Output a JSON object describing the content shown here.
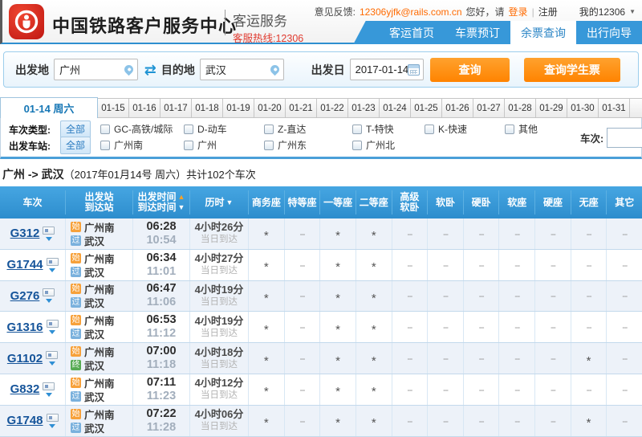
{
  "colors": {
    "nav_blue": "#3798d9",
    "table_header_blue": "#2d8dcd",
    "accent_orange": "#ff8300",
    "link_orange": "#ff6a00",
    "hotline_red": "#e03a2f",
    "active_tab_blue": "#1576b5",
    "badge_start": "#f7a13a",
    "badge_pass": "#7ab1dd",
    "badge_end": "#56ab53"
  },
  "header": {
    "title": "中国铁路客户服务中心",
    "subtitle": "客运服务",
    "hotline": "客服热线:12306",
    "feedback_label": "意见反馈:",
    "feedback_email": "12306yjfk@rails.com.cn",
    "greeting": "您好，请",
    "login": "登录",
    "divider": "|",
    "register": "注册",
    "my_account": "我的12306"
  },
  "nav": {
    "items": [
      {
        "label": "客运首页",
        "active": false
      },
      {
        "label": "车票预订",
        "active": false
      },
      {
        "label": "余票查询",
        "active": true
      },
      {
        "label": "出行向导",
        "active": false
      }
    ]
  },
  "search": {
    "from_label": "出发地",
    "from_value": "广州",
    "to_label": "目的地",
    "to_value": "武汉",
    "date_label": "出发日",
    "date_value": "2017-01-14",
    "query_button": "查询",
    "student_button": "查询学生票"
  },
  "date_tabs": {
    "active": "01-14 周六",
    "others": [
      "01-15",
      "01-16",
      "01-17",
      "01-18",
      "01-19",
      "01-20",
      "01-21",
      "01-22",
      "01-23",
      "01-24",
      "01-25",
      "01-26",
      "01-27",
      "01-28",
      "01-29",
      "01-30",
      "01-31"
    ]
  },
  "filters": {
    "type_label": "车次类型:",
    "all_label": "全部",
    "type_options": [
      "GC-高铁/城际",
      "D-动车",
      "Z-直达",
      "T-特快",
      "K-快速",
      "其他"
    ],
    "station_label": "出发车站:",
    "station_options": [
      "广州南",
      "广州",
      "广州东",
      "广州北"
    ],
    "train_no_label": "车次:"
  },
  "summary": {
    "route": "广州 -> 武汉",
    "rest": "（2017年01月14号  周六）共计102个车次"
  },
  "table": {
    "columns": [
      {
        "lines": [
          {
            "t": "车次"
          }
        ]
      },
      {
        "lines": [
          {
            "t": "出发站"
          },
          {
            "t": "到达站"
          }
        ]
      },
      {
        "lines": [
          {
            "t": "出发时间",
            "arrow": "up"
          },
          {
            "t": "到达时间",
            "arrow": "down"
          }
        ]
      },
      {
        "lines": [
          {
            "t": "历时",
            "arrow": "down"
          }
        ]
      },
      {
        "lines": [
          {
            "t": "商务座"
          }
        ]
      },
      {
        "lines": [
          {
            "t": "特等座"
          }
        ]
      },
      {
        "lines": [
          {
            "t": "一等座"
          }
        ]
      },
      {
        "lines": [
          {
            "t": "二等座"
          }
        ]
      },
      {
        "lines": [
          {
            "t": "高级"
          },
          {
            "t": "软卧"
          }
        ]
      },
      {
        "lines": [
          {
            "t": "软卧"
          }
        ]
      },
      {
        "lines": [
          {
            "t": "硬卧"
          }
        ]
      },
      {
        "lines": [
          {
            "t": "软座"
          }
        ]
      },
      {
        "lines": [
          {
            "t": "硬座"
          }
        ]
      },
      {
        "lines": [
          {
            "t": "无座"
          }
        ]
      },
      {
        "lines": [
          {
            "t": "其它"
          }
        ]
      }
    ],
    "rows": [
      {
        "train": "G312",
        "from_badge": "始",
        "from": "广州南",
        "to_badge": "过",
        "to": "武汉",
        "dep": "06:28",
        "arr": "10:54",
        "duration": "4小时26分",
        "arrival_day": "当日到达",
        "seats": [
          "*",
          "--",
          "*",
          "*",
          "--",
          "--",
          "--",
          "--",
          "--",
          "--",
          "--"
        ]
      },
      {
        "train": "G1744",
        "from_badge": "始",
        "from": "广州南",
        "to_badge": "过",
        "to": "武汉",
        "dep": "06:34",
        "arr": "11:01",
        "duration": "4小时27分",
        "arrival_day": "当日到达",
        "seats": [
          "*",
          "--",
          "*",
          "*",
          "--",
          "--",
          "--",
          "--",
          "--",
          "--",
          "--"
        ]
      },
      {
        "train": "G276",
        "from_badge": "始",
        "from": "广州南",
        "to_badge": "过",
        "to": "武汉",
        "dep": "06:47",
        "arr": "11:06",
        "duration": "4小时19分",
        "arrival_day": "当日到达",
        "seats": [
          "*",
          "--",
          "*",
          "*",
          "--",
          "--",
          "--",
          "--",
          "--",
          "--",
          "--"
        ]
      },
      {
        "train": "G1316",
        "from_badge": "始",
        "from": "广州南",
        "to_badge": "过",
        "to": "武汉",
        "dep": "06:53",
        "arr": "11:12",
        "duration": "4小时19分",
        "arrival_day": "当日到达",
        "seats": [
          "*",
          "--",
          "*",
          "*",
          "--",
          "--",
          "--",
          "--",
          "--",
          "--",
          "--"
        ]
      },
      {
        "train": "G1102",
        "from_badge": "始",
        "from": "广州南",
        "to_badge": "终",
        "to": "武汉",
        "dep": "07:00",
        "arr": "11:18",
        "duration": "4小时18分",
        "arrival_day": "当日到达",
        "seats": [
          "*",
          "--",
          "*",
          "*",
          "--",
          "--",
          "--",
          "--",
          "--",
          "*",
          "--"
        ]
      },
      {
        "train": "G832",
        "from_badge": "始",
        "from": "广州南",
        "to_badge": "过",
        "to": "武汉",
        "dep": "07:11",
        "arr": "11:23",
        "duration": "4小时12分",
        "arrival_day": "当日到达",
        "seats": [
          "*",
          "--",
          "*",
          "*",
          "--",
          "--",
          "--",
          "--",
          "--",
          "--",
          "--"
        ]
      },
      {
        "train": "G1748",
        "from_badge": "始",
        "from": "广州南",
        "to_badge": "过",
        "to": "武汉",
        "dep": "07:22",
        "arr": "11:28",
        "duration": "4小时06分",
        "arrival_day": "当日到达",
        "seats": [
          "*",
          "--",
          "*",
          "*",
          "--",
          "--",
          "--",
          "--",
          "--",
          "*",
          "--"
        ]
      }
    ]
  }
}
